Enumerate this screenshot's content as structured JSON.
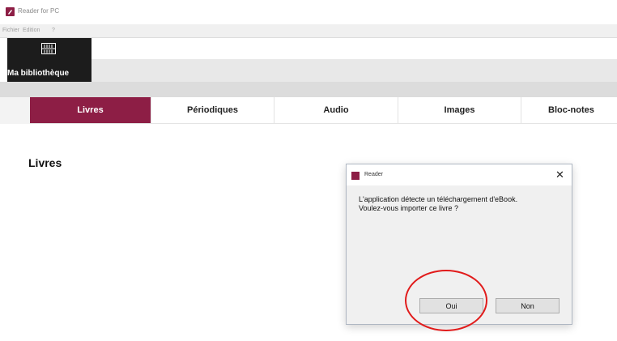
{
  "window": {
    "title": "Reader for PC"
  },
  "menu": [
    "Fichier",
    "Edition",
    "?"
  ],
  "library_button": {
    "label": "Ma bibliothèque"
  },
  "tabs": [
    {
      "label": "Livres",
      "active": true
    },
    {
      "label": "Périodiques",
      "active": false
    },
    {
      "label": "Audio",
      "active": false
    },
    {
      "label": "Images",
      "active": false
    },
    {
      "label": "Bloc-notes",
      "active": false
    }
  ],
  "section": {
    "title": "Livres"
  },
  "dialog": {
    "title": "Reader",
    "message_line1": "L'application détecte un téléchargement d'eBook.",
    "message_line2": "Voulez-vous importer ce livre ?",
    "buttons": {
      "yes": "Oui",
      "no": "Non"
    },
    "close_icon": "close-icon"
  },
  "colors": {
    "accent": "#8d1e45",
    "highlight": "#e11b1b",
    "library_button_bg": "#1c1c1c"
  }
}
